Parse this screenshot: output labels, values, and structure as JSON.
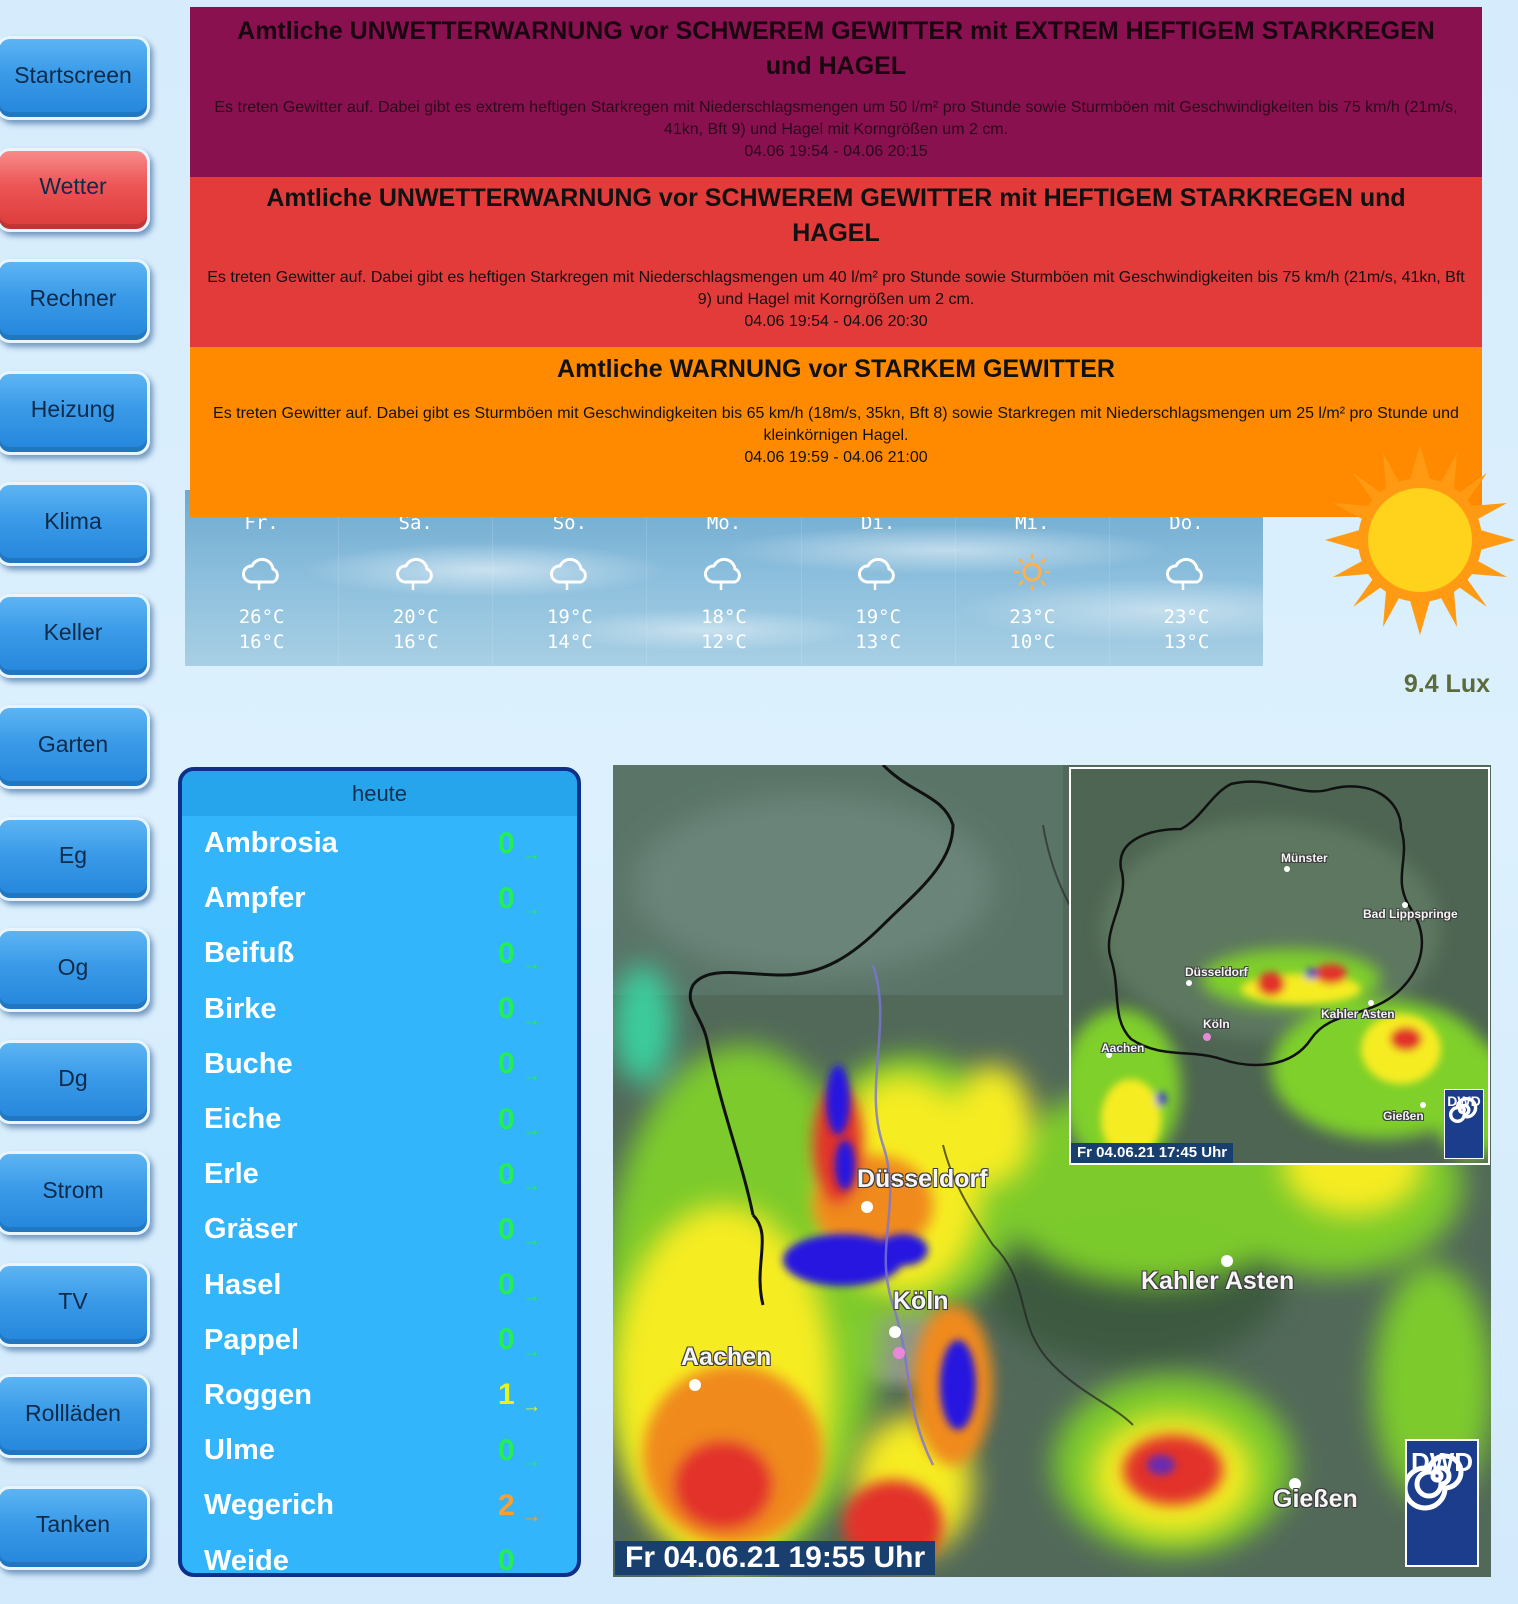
{
  "nav": [
    {
      "label": "Startscreen",
      "active": false
    },
    {
      "label": "Wetter",
      "active": true
    },
    {
      "label": "Rechner",
      "active": false
    },
    {
      "label": "Heizung",
      "active": false
    },
    {
      "label": "Klima",
      "active": false
    },
    {
      "label": "Keller",
      "active": false
    },
    {
      "label": "Garten",
      "active": false
    },
    {
      "label": "Eg",
      "active": false
    },
    {
      "label": "Og",
      "active": false
    },
    {
      "label": "Dg",
      "active": false
    },
    {
      "label": "Strom",
      "active": false
    },
    {
      "label": "TV",
      "active": false
    },
    {
      "label": "Rollläden",
      "active": false
    },
    {
      "label": "Tanken",
      "active": false
    }
  ],
  "warnings": [
    {
      "title": "Amtliche UNWETTERWARNUNG vor SCHWEREM GEWITTER mit EXTREM HEFTIGEM STARKREGEN und HAGEL",
      "text": "Es treten Gewitter auf. Dabei gibt es extrem heftigen Starkregen mit Niederschlagsmengen um 50 l/m² pro Stunde sowie Sturmböen mit Geschwindigkeiten bis 75 km/h (21m/s, 41kn, Bft 9) und Hagel mit Korngrößen um 2 cm.",
      "time": "04.06 19:54 - 04.06 20:15",
      "color": "#8a1150"
    },
    {
      "title": "Amtliche UNWETTERWARNUNG vor SCHWEREM GEWITTER mit HEFTIGEM STARKREGEN und HAGEL",
      "text": "Es treten Gewitter auf. Dabei gibt es heftigen Starkregen mit Niederschlagsmengen um 40 l/m² pro Stunde sowie Sturmböen mit Geschwindigkeiten bis 75 km/h (21m/s, 41kn, Bft 9) und Hagel mit Korngrößen um 2 cm.",
      "time": "04.06 19:54 - 04.06 20:30",
      "color": "#e33a3a"
    },
    {
      "title": "Amtliche WARNUNG vor STARKEM GEWITTER",
      "text": "Es treten Gewitter auf. Dabei gibt es Sturmböen mit Geschwindigkeiten bis 65 km/h (18m/s, 35kn, Bft 8) sowie Starkregen mit Niederschlagsmengen um 25 l/m² pro Stunde und kleinkörnigen Hagel.",
      "time": "04.06 19:59 - 04.06 21:00",
      "color": "#ff8a00"
    }
  ],
  "forecast": [
    {
      "day": "Fr.",
      "icon": "cloud-icon",
      "high": "26°C",
      "low": "16°C"
    },
    {
      "day": "Sa.",
      "icon": "cloud-icon",
      "high": "20°C",
      "low": "16°C"
    },
    {
      "day": "So.",
      "icon": "cloud-icon",
      "high": "19°C",
      "low": "14°C"
    },
    {
      "day": "Mo.",
      "icon": "cloud-icon",
      "high": "18°C",
      "low": "12°C"
    },
    {
      "day": "Di.",
      "icon": "cloud-icon",
      "high": "19°C",
      "low": "13°C"
    },
    {
      "day": "Mi.",
      "icon": "sun-icon",
      "high": "23°C",
      "low": "10°C"
    },
    {
      "day": "Do.",
      "icon": "cloud-icon",
      "high": "23°C",
      "low": "13°C"
    }
  ],
  "light": {
    "value": "9.4 Lux",
    "icon": "sun-icon"
  },
  "pollen": {
    "header": "heute",
    "items": [
      {
        "name": "Ambrosia",
        "value": "0",
        "trend": "→"
      },
      {
        "name": "Ampfer",
        "value": "0",
        "trend": "→"
      },
      {
        "name": "Beifuß",
        "value": "0",
        "trend": "→"
      },
      {
        "name": "Birke",
        "value": "0",
        "trend": "→"
      },
      {
        "name": "Buche",
        "value": "0",
        "trend": "→"
      },
      {
        "name": "Eiche",
        "value": "0",
        "trend": "→"
      },
      {
        "name": "Erle",
        "value": "0",
        "trend": "→"
      },
      {
        "name": "Gräser",
        "value": "0",
        "trend": "→"
      },
      {
        "name": "Hasel",
        "value": "0",
        "trend": "→"
      },
      {
        "name": "Pappel",
        "value": "0",
        "trend": "→"
      },
      {
        "name": "Roggen",
        "value": "1",
        "trend": "→"
      },
      {
        "name": "Ulme",
        "value": "0",
        "trend": "→"
      },
      {
        "name": "Wegerich",
        "value": "2",
        "trend": "→"
      },
      {
        "name": "Weide",
        "value": "0",
        "trend": "→"
      }
    ]
  },
  "radar": {
    "timestamp": "Fr 04.06.21  19:55 Uhr",
    "logo": "DWD",
    "cities": [
      "Düsseldorf",
      "Köln",
      "Aachen",
      "Kahler Asten",
      "Gießen"
    ],
    "inset": {
      "timestamp": "Fr 04.06.21  17:45 Uhr",
      "logo": "DWD",
      "cities": [
        "Münster",
        "Bad Lippspringe",
        "Düsseldorf",
        "Köln",
        "Aachen",
        "Kahler Asten",
        "Gießen"
      ]
    }
  },
  "colors": {
    "nav_button": "#3a9ae8",
    "nav_button_active": "#ec5454",
    "pollen_bg": "#33b5fb",
    "pollen_border": "#0c2f8a",
    "sun": "#ffd21c",
    "sun_rays": "#ff9a12"
  }
}
